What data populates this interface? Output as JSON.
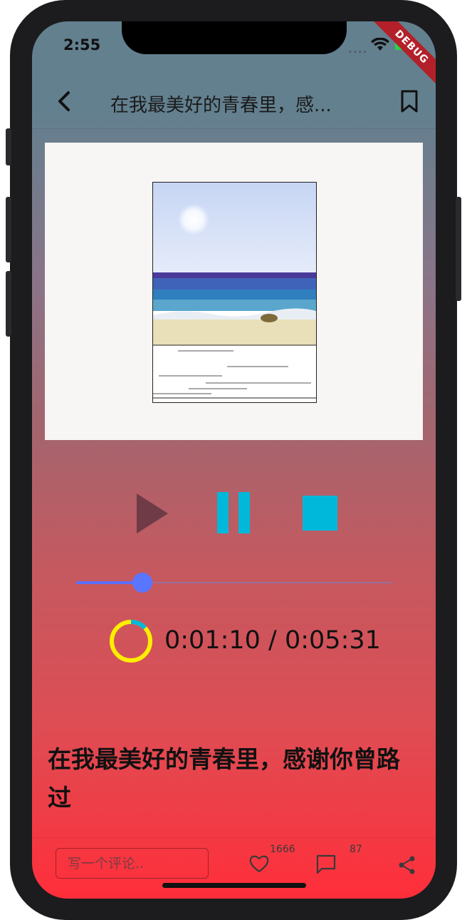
{
  "status": {
    "time": "2:55",
    "debug": "DEBUG"
  },
  "appbar": {
    "title": "在我最美好的青春里，感..."
  },
  "player": {
    "elapsed": "0:01:10",
    "total": "0:05:31",
    "time_text": "0:01:10 / 0:05:31",
    "progress": 0.21
  },
  "article": {
    "title": "在我最美好的青春里，感谢你曾路过"
  },
  "bottom": {
    "comment_placeholder": "写一个评论..",
    "like_count": "1666",
    "comment_count": "87"
  },
  "colors": {
    "accent_cyan": "#00b8d9",
    "play_color": "#6f3b46",
    "slider": "#5a75ff",
    "ring": "#ffee00"
  }
}
